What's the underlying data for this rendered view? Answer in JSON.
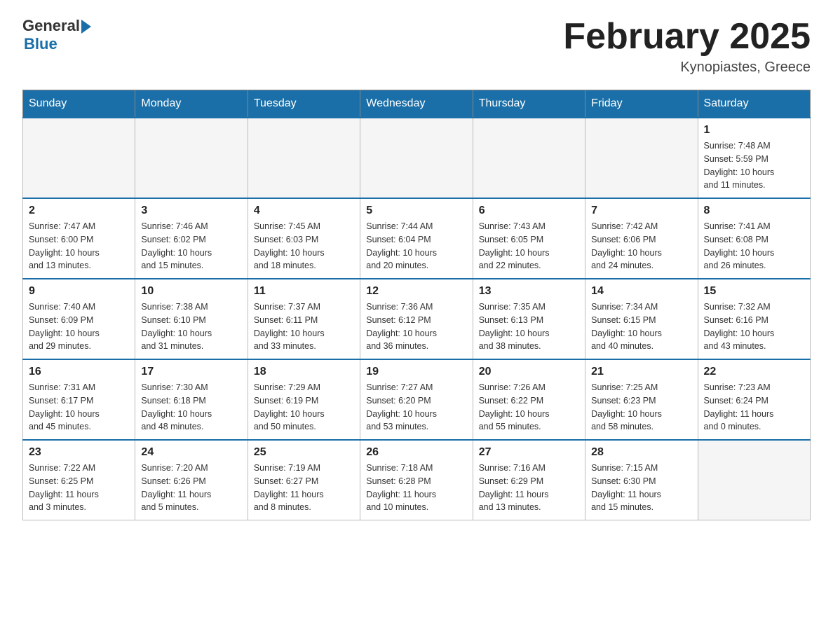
{
  "header": {
    "logo_general": "General",
    "logo_blue": "Blue",
    "month_title": "February 2025",
    "location": "Kynopiastes, Greece"
  },
  "days_of_week": [
    "Sunday",
    "Monday",
    "Tuesday",
    "Wednesday",
    "Thursday",
    "Friday",
    "Saturday"
  ],
  "weeks": [
    [
      {
        "day": "",
        "info": ""
      },
      {
        "day": "",
        "info": ""
      },
      {
        "day": "",
        "info": ""
      },
      {
        "day": "",
        "info": ""
      },
      {
        "day": "",
        "info": ""
      },
      {
        "day": "",
        "info": ""
      },
      {
        "day": "1",
        "info": "Sunrise: 7:48 AM\nSunset: 5:59 PM\nDaylight: 10 hours\nand 11 minutes."
      }
    ],
    [
      {
        "day": "2",
        "info": "Sunrise: 7:47 AM\nSunset: 6:00 PM\nDaylight: 10 hours\nand 13 minutes."
      },
      {
        "day": "3",
        "info": "Sunrise: 7:46 AM\nSunset: 6:02 PM\nDaylight: 10 hours\nand 15 minutes."
      },
      {
        "day": "4",
        "info": "Sunrise: 7:45 AM\nSunset: 6:03 PM\nDaylight: 10 hours\nand 18 minutes."
      },
      {
        "day": "5",
        "info": "Sunrise: 7:44 AM\nSunset: 6:04 PM\nDaylight: 10 hours\nand 20 minutes."
      },
      {
        "day": "6",
        "info": "Sunrise: 7:43 AM\nSunset: 6:05 PM\nDaylight: 10 hours\nand 22 minutes."
      },
      {
        "day": "7",
        "info": "Sunrise: 7:42 AM\nSunset: 6:06 PM\nDaylight: 10 hours\nand 24 minutes."
      },
      {
        "day": "8",
        "info": "Sunrise: 7:41 AM\nSunset: 6:08 PM\nDaylight: 10 hours\nand 26 minutes."
      }
    ],
    [
      {
        "day": "9",
        "info": "Sunrise: 7:40 AM\nSunset: 6:09 PM\nDaylight: 10 hours\nand 29 minutes."
      },
      {
        "day": "10",
        "info": "Sunrise: 7:38 AM\nSunset: 6:10 PM\nDaylight: 10 hours\nand 31 minutes."
      },
      {
        "day": "11",
        "info": "Sunrise: 7:37 AM\nSunset: 6:11 PM\nDaylight: 10 hours\nand 33 minutes."
      },
      {
        "day": "12",
        "info": "Sunrise: 7:36 AM\nSunset: 6:12 PM\nDaylight: 10 hours\nand 36 minutes."
      },
      {
        "day": "13",
        "info": "Sunrise: 7:35 AM\nSunset: 6:13 PM\nDaylight: 10 hours\nand 38 minutes."
      },
      {
        "day": "14",
        "info": "Sunrise: 7:34 AM\nSunset: 6:15 PM\nDaylight: 10 hours\nand 40 minutes."
      },
      {
        "day": "15",
        "info": "Sunrise: 7:32 AM\nSunset: 6:16 PM\nDaylight: 10 hours\nand 43 minutes."
      }
    ],
    [
      {
        "day": "16",
        "info": "Sunrise: 7:31 AM\nSunset: 6:17 PM\nDaylight: 10 hours\nand 45 minutes."
      },
      {
        "day": "17",
        "info": "Sunrise: 7:30 AM\nSunset: 6:18 PM\nDaylight: 10 hours\nand 48 minutes."
      },
      {
        "day": "18",
        "info": "Sunrise: 7:29 AM\nSunset: 6:19 PM\nDaylight: 10 hours\nand 50 minutes."
      },
      {
        "day": "19",
        "info": "Sunrise: 7:27 AM\nSunset: 6:20 PM\nDaylight: 10 hours\nand 53 minutes."
      },
      {
        "day": "20",
        "info": "Sunrise: 7:26 AM\nSunset: 6:22 PM\nDaylight: 10 hours\nand 55 minutes."
      },
      {
        "day": "21",
        "info": "Sunrise: 7:25 AM\nSunset: 6:23 PM\nDaylight: 10 hours\nand 58 minutes."
      },
      {
        "day": "22",
        "info": "Sunrise: 7:23 AM\nSunset: 6:24 PM\nDaylight: 11 hours\nand 0 minutes."
      }
    ],
    [
      {
        "day": "23",
        "info": "Sunrise: 7:22 AM\nSunset: 6:25 PM\nDaylight: 11 hours\nand 3 minutes."
      },
      {
        "day": "24",
        "info": "Sunrise: 7:20 AM\nSunset: 6:26 PM\nDaylight: 11 hours\nand 5 minutes."
      },
      {
        "day": "25",
        "info": "Sunrise: 7:19 AM\nSunset: 6:27 PM\nDaylight: 11 hours\nand 8 minutes."
      },
      {
        "day": "26",
        "info": "Sunrise: 7:18 AM\nSunset: 6:28 PM\nDaylight: 11 hours\nand 10 minutes."
      },
      {
        "day": "27",
        "info": "Sunrise: 7:16 AM\nSunset: 6:29 PM\nDaylight: 11 hours\nand 13 minutes."
      },
      {
        "day": "28",
        "info": "Sunrise: 7:15 AM\nSunset: 6:30 PM\nDaylight: 11 hours\nand 15 minutes."
      },
      {
        "day": "",
        "info": ""
      }
    ]
  ]
}
